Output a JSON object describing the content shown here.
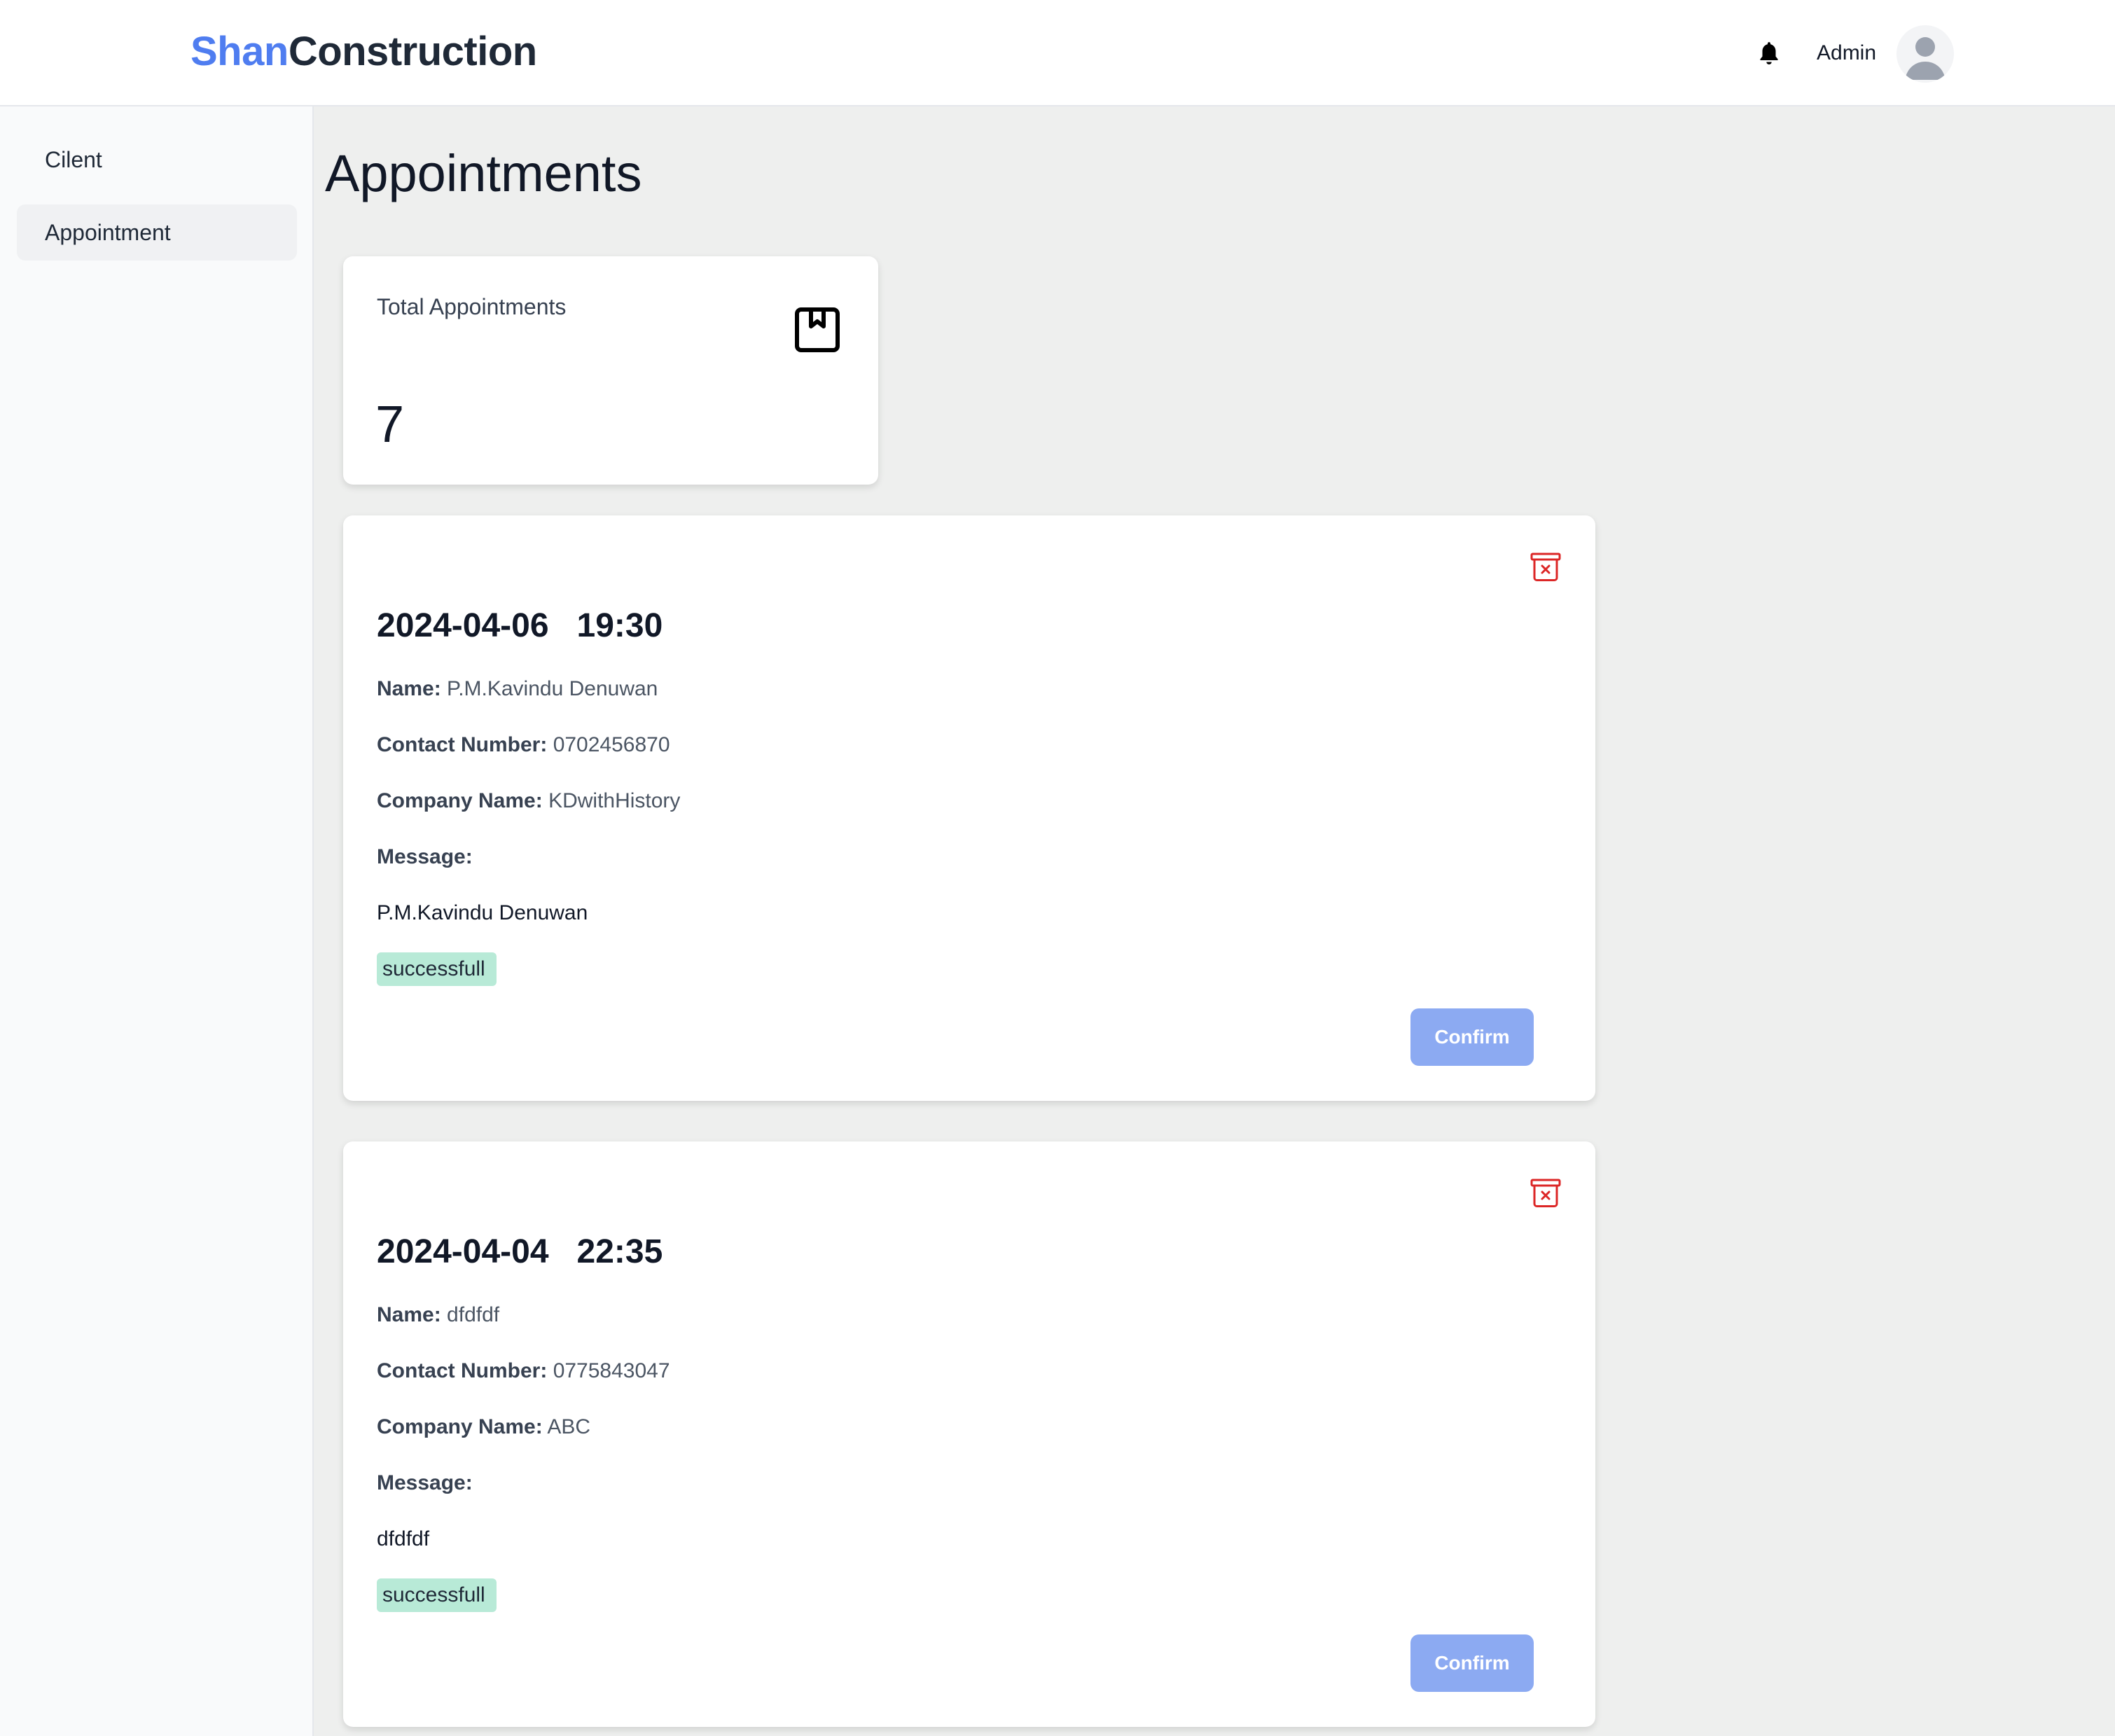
{
  "header": {
    "brand_primary": "Shan",
    "brand_secondary": "Construction",
    "user_label": "Admin",
    "icons": [
      "bell-icon",
      "user-avatar-icon"
    ]
  },
  "sidebar": {
    "items": [
      {
        "label": "Cilent",
        "active": false
      },
      {
        "label": "Appointment",
        "active": true
      }
    ]
  },
  "main": {
    "title": "Appointments",
    "stat": {
      "label": "Total Appointments",
      "value": "7",
      "icon": "bookmark-album-icon"
    },
    "appointments": [
      {
        "datetime": "2024-04-06   19:30",
        "name_label": "Name:",
        "name": "P.M.Kavindu Denuwan",
        "contact_label": "Contact Number:",
        "contact": "0702456870",
        "company_label": "Company Name:",
        "company": "KDwithHistory",
        "message_label": "Message:",
        "message": "P.M.Kavindu Denuwan",
        "status": "successfull",
        "confirm_label": "Confirm"
      },
      {
        "datetime": "2024-04-04   22:35",
        "name_label": "Name:",
        "name": "dfdfdf",
        "contact_label": "Contact Number:",
        "contact": "0775843047",
        "company_label": "Company Name:",
        "company": "ABC",
        "message_label": "Message:",
        "message": "dfdfdf",
        "status": "successfull",
        "confirm_label": "Confirm"
      }
    ]
  },
  "colors": {
    "brand_blue": "#4f7df0",
    "status_green_bg": "#b8ead7",
    "confirm_button": "#8caaf2",
    "delete_red": "#dc2626",
    "page_bg": "#eeefee"
  }
}
